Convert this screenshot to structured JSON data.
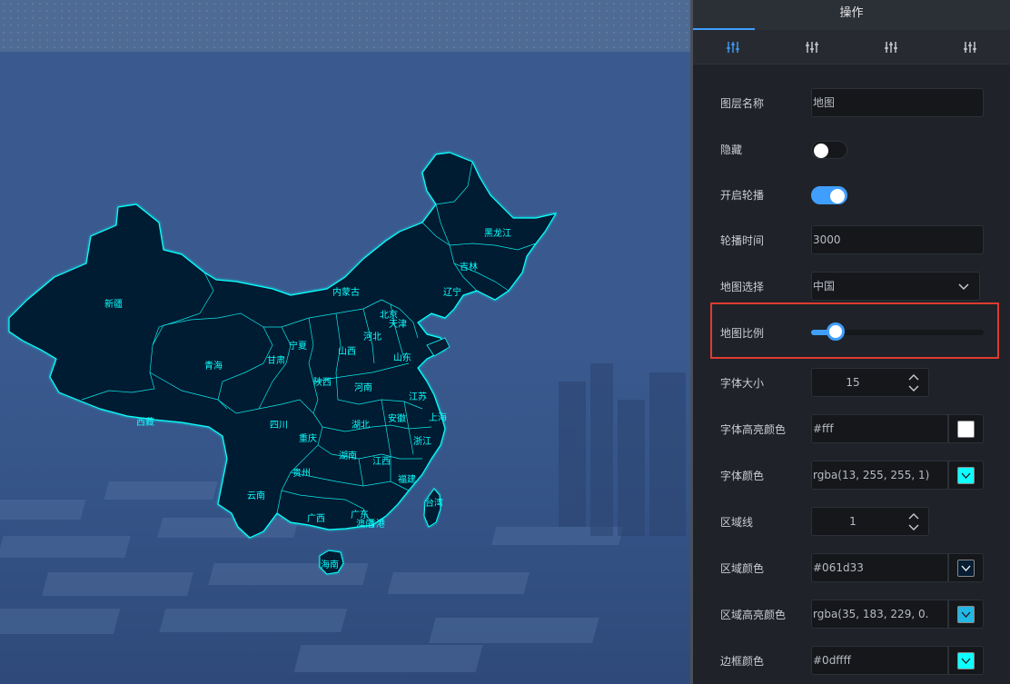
{
  "panel": {
    "title": "操作",
    "tabs": [
      {
        "icon": "sliders-icon"
      },
      {
        "icon": "sliders-icon"
      },
      {
        "icon": "sliders-icon"
      },
      {
        "icon": "sliders-icon"
      }
    ],
    "fields": {
      "layer_name": {
        "label": "图层名称",
        "value": "地图"
      },
      "hide": {
        "label": "隐藏",
        "checked": false
      },
      "carousel": {
        "label": "开启轮播",
        "checked": true
      },
      "carousel_time": {
        "label": "轮播时间",
        "value": "3000"
      },
      "map_select": {
        "label": "地图选择",
        "value": "中国"
      },
      "map_scale": {
        "label": "地图比例",
        "value_fraction": 0.14
      },
      "font_size": {
        "label": "字体大小",
        "value": "15"
      },
      "font_highlight_color": {
        "label": "字体高亮颜色",
        "value": "#fff",
        "swatch": "#ffffff"
      },
      "font_color": {
        "label": "字体颜色",
        "value": "rgba(13, 255, 255, 1)",
        "swatch": "#0dffff"
      },
      "region_line": {
        "label": "区域线",
        "value": "1"
      },
      "region_color": {
        "label": "区域颜色",
        "value": "#061d33",
        "swatch": "#061d33"
      },
      "region_highlight_color": {
        "label": "区域高亮颜色",
        "value": "rgba(35, 183, 229, 0.",
        "swatch": "#23b7e5"
      },
      "border_color": {
        "label": "边框颜色",
        "value": "#0dffff",
        "swatch": "#0dffff"
      }
    }
  },
  "map": {
    "region_color": "#061d33",
    "border_color": "#0dffff",
    "label_color": "#0dffff",
    "provinces": [
      "黑龙江",
      "吉林",
      "辽宁",
      "内蒙古",
      "北京",
      "天津",
      "河北",
      "宁夏",
      "山西",
      "山东",
      "甘肃",
      "新疆",
      "青海",
      "陕西",
      "河南",
      "江苏",
      "西藏",
      "四川",
      "湖北",
      "安徽",
      "上海",
      "重庆",
      "浙江",
      "湖南",
      "江西",
      "贵州",
      "福建",
      "云南",
      "广西",
      "广东",
      "台湾",
      "香港",
      "澳门",
      "海南"
    ]
  }
}
